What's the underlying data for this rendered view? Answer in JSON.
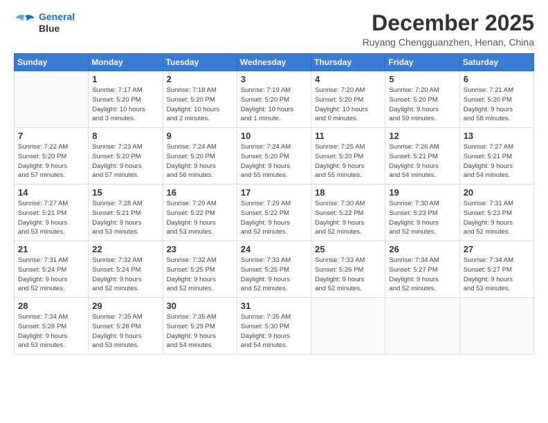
{
  "header": {
    "logo_line1": "General",
    "logo_line2": "Blue",
    "month_title": "December 2025",
    "location": "Ruyang Chengguanzhen, Henan, China"
  },
  "weekdays": [
    "Sunday",
    "Monday",
    "Tuesday",
    "Wednesday",
    "Thursday",
    "Friday",
    "Saturday"
  ],
  "weeks": [
    [
      {
        "day": "",
        "info": ""
      },
      {
        "day": "1",
        "info": "Sunrise: 7:17 AM\nSunset: 5:20 PM\nDaylight: 10 hours\nand 3 minutes."
      },
      {
        "day": "2",
        "info": "Sunrise: 7:18 AM\nSunset: 5:20 PM\nDaylight: 10 hours\nand 2 minutes."
      },
      {
        "day": "3",
        "info": "Sunrise: 7:19 AM\nSunset: 5:20 PM\nDaylight: 10 hours\nand 1 minute."
      },
      {
        "day": "4",
        "info": "Sunrise: 7:20 AM\nSunset: 5:20 PM\nDaylight: 10 hours\nand 0 minutes."
      },
      {
        "day": "5",
        "info": "Sunrise: 7:20 AM\nSunset: 5:20 PM\nDaylight: 9 hours\nand 59 minutes."
      },
      {
        "day": "6",
        "info": "Sunrise: 7:21 AM\nSunset: 5:20 PM\nDaylight: 9 hours\nand 58 minutes."
      }
    ],
    [
      {
        "day": "7",
        "info": "Sunrise: 7:22 AM\nSunset: 5:20 PM\nDaylight: 9 hours\nand 57 minutes."
      },
      {
        "day": "8",
        "info": "Sunrise: 7:23 AM\nSunset: 5:20 PM\nDaylight: 9 hours\nand 57 minutes."
      },
      {
        "day": "9",
        "info": "Sunrise: 7:24 AM\nSunset: 5:20 PM\nDaylight: 9 hours\nand 56 minutes."
      },
      {
        "day": "10",
        "info": "Sunrise: 7:24 AM\nSunset: 5:20 PM\nDaylight: 9 hours\nand 55 minutes."
      },
      {
        "day": "11",
        "info": "Sunrise: 7:25 AM\nSunset: 5:20 PM\nDaylight: 9 hours\nand 55 minutes."
      },
      {
        "day": "12",
        "info": "Sunrise: 7:26 AM\nSunset: 5:21 PM\nDaylight: 9 hours\nand 54 minutes."
      },
      {
        "day": "13",
        "info": "Sunrise: 7:27 AM\nSunset: 5:21 PM\nDaylight: 9 hours\nand 54 minutes."
      }
    ],
    [
      {
        "day": "14",
        "info": "Sunrise: 7:27 AM\nSunset: 5:21 PM\nDaylight: 9 hours\nand 53 minutes."
      },
      {
        "day": "15",
        "info": "Sunrise: 7:28 AM\nSunset: 5:21 PM\nDaylight: 9 hours\nand 53 minutes."
      },
      {
        "day": "16",
        "info": "Sunrise: 7:29 AM\nSunset: 5:22 PM\nDaylight: 9 hours\nand 53 minutes."
      },
      {
        "day": "17",
        "info": "Sunrise: 7:29 AM\nSunset: 5:22 PM\nDaylight: 9 hours\nand 52 minutes."
      },
      {
        "day": "18",
        "info": "Sunrise: 7:30 AM\nSunset: 5:22 PM\nDaylight: 9 hours\nand 52 minutes."
      },
      {
        "day": "19",
        "info": "Sunrise: 7:30 AM\nSunset: 5:23 PM\nDaylight: 9 hours\nand 52 minutes."
      },
      {
        "day": "20",
        "info": "Sunrise: 7:31 AM\nSunset: 5:23 PM\nDaylight: 9 hours\nand 52 minutes."
      }
    ],
    [
      {
        "day": "21",
        "info": "Sunrise: 7:31 AM\nSunset: 5:24 PM\nDaylight: 9 hours\nand 52 minutes."
      },
      {
        "day": "22",
        "info": "Sunrise: 7:32 AM\nSunset: 5:24 PM\nDaylight: 9 hours\nand 52 minutes."
      },
      {
        "day": "23",
        "info": "Sunrise: 7:32 AM\nSunset: 5:25 PM\nDaylight: 9 hours\nand 52 minutes."
      },
      {
        "day": "24",
        "info": "Sunrise: 7:33 AM\nSunset: 5:25 PM\nDaylight: 9 hours\nand 52 minutes."
      },
      {
        "day": "25",
        "info": "Sunrise: 7:33 AM\nSunset: 5:26 PM\nDaylight: 9 hours\nand 52 minutes."
      },
      {
        "day": "26",
        "info": "Sunrise: 7:34 AM\nSunset: 5:27 PM\nDaylight: 9 hours\nand 52 minutes."
      },
      {
        "day": "27",
        "info": "Sunrise: 7:34 AM\nSunset: 5:27 PM\nDaylight: 9 hours\nand 53 minutes."
      }
    ],
    [
      {
        "day": "28",
        "info": "Sunrise: 7:34 AM\nSunset: 5:28 PM\nDaylight: 9 hours\nand 53 minutes."
      },
      {
        "day": "29",
        "info": "Sunrise: 7:35 AM\nSunset: 5:28 PM\nDaylight: 9 hours\nand 53 minutes."
      },
      {
        "day": "30",
        "info": "Sunrise: 7:35 AM\nSunset: 5:29 PM\nDaylight: 9 hours\nand 54 minutes."
      },
      {
        "day": "31",
        "info": "Sunrise: 7:35 AM\nSunset: 5:30 PM\nDaylight: 9 hours\nand 54 minutes."
      },
      {
        "day": "",
        "info": ""
      },
      {
        "day": "",
        "info": ""
      },
      {
        "day": "",
        "info": ""
      }
    ]
  ]
}
